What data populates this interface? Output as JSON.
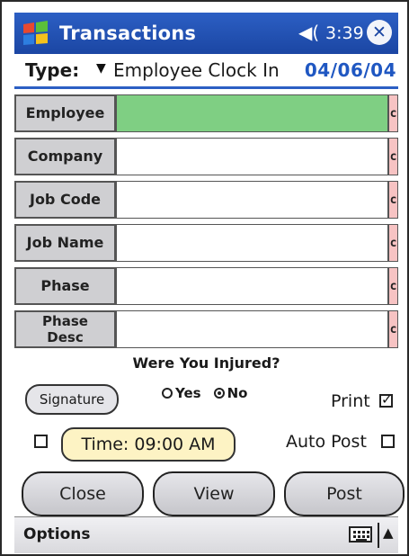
{
  "window": {
    "title": "Transactions",
    "time": "3:39",
    "speaker_icon": "speaker-icon",
    "close_icon": "close-icon"
  },
  "type_row": {
    "label": "Type:",
    "value": "Employee Clock In",
    "date": "04/06/04"
  },
  "fields": [
    {
      "label": "Employee",
      "active": true
    },
    {
      "label": "Company",
      "active": false
    },
    {
      "label": "Job Code",
      "active": false
    },
    {
      "label": "Job Name",
      "active": false
    },
    {
      "label": "Phase",
      "active": false
    },
    {
      "label": "Phase Desc",
      "active": false
    }
  ],
  "field_suffix": "c",
  "injured": {
    "question": "Were You Injured?",
    "yes_label": "Yes",
    "no_label": "No",
    "selected": "No"
  },
  "signature_button": "Signature",
  "print": {
    "label": "Print",
    "checked": true
  },
  "time_button": "Time: 09:00 AM",
  "time_checkbox_checked": false,
  "auto_post": {
    "label": "Auto Post",
    "checked": false
  },
  "buttons": {
    "close": "Close",
    "view": "View",
    "post": "Post"
  },
  "menu": {
    "options": "Options",
    "keyboard_icon": "keyboard-icon"
  },
  "colors": {
    "titlebar": "#1b46a3",
    "active_field": "#7fcf83",
    "date_text": "#1f57c2",
    "suffix_bg": "#f7c3c3"
  }
}
